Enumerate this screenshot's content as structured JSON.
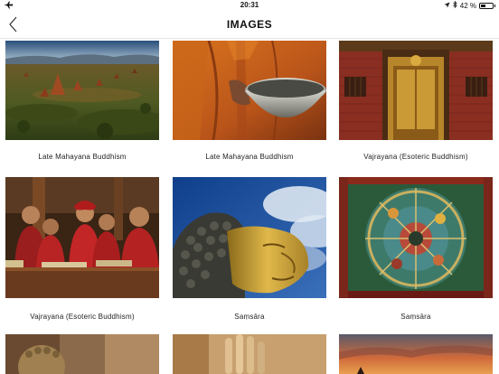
{
  "status_bar": {
    "time": "20:31",
    "battery_text": "42 %",
    "battery_level": 0.42,
    "icons": [
      "airplane-icon",
      "location-icon",
      "bluetooth-icon",
      "battery-icon"
    ]
  },
  "nav": {
    "title": "IMAGES",
    "back_icon": "chevron-left-icon"
  },
  "images": [
    {
      "caption": "Late Mahayana Buddhism",
      "scene": "temple-plain"
    },
    {
      "caption": "Late Mahayana Buddhism",
      "scene": "monk-alms-bowl"
    },
    {
      "caption": "Vajrayana (Esoteric Buddhism)",
      "scene": "golden-door"
    },
    {
      "caption": "Vajrayana (Esoteric Buddhism)",
      "scene": "young-monks"
    },
    {
      "caption": "Saṃsāra",
      "scene": "golden-buddha-head"
    },
    {
      "caption": "Saṃsāra",
      "scene": "wheel-of-life"
    },
    {
      "caption": "",
      "scene": "partial-statue"
    },
    {
      "caption": "",
      "scene": "partial-hand"
    },
    {
      "caption": "",
      "scene": "partial-sunset"
    }
  ],
  "colors": {
    "background": "#ffffff",
    "text": "#111111",
    "divider": "#e6e6e6"
  }
}
